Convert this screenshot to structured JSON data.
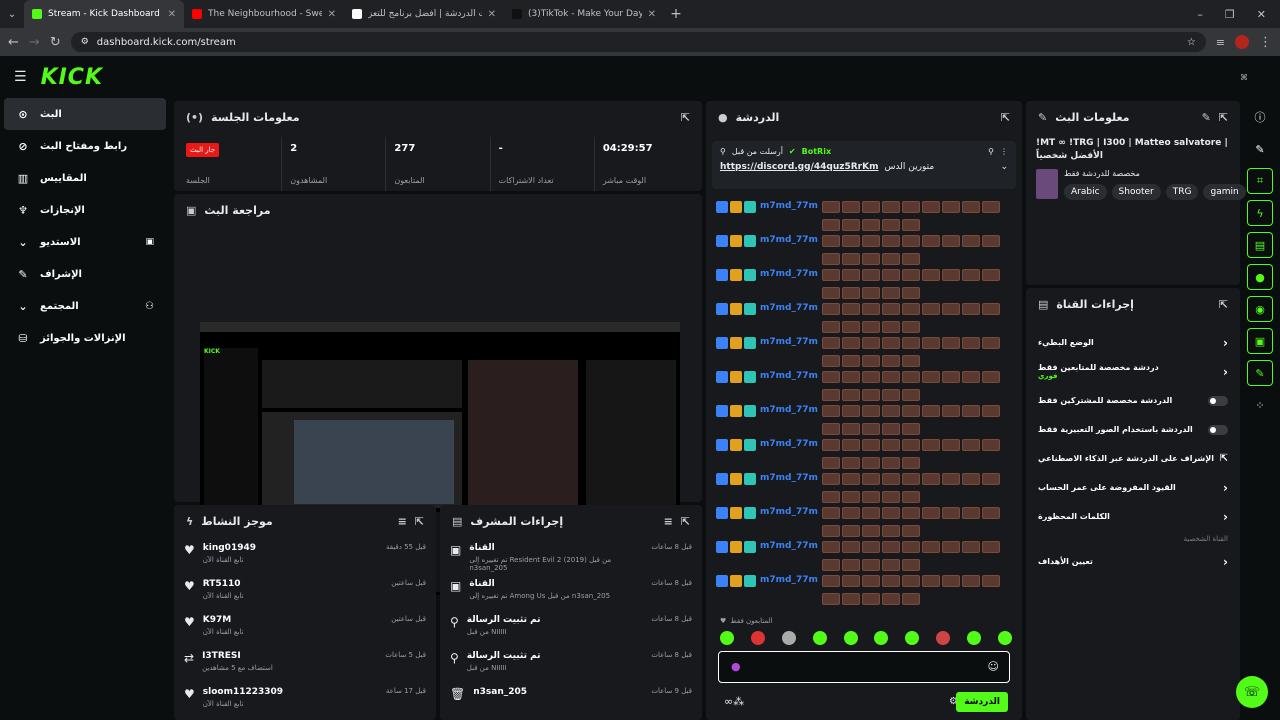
{
  "browser": {
    "tabs": [
      {
        "title": "Stream - Kick Dashboard",
        "favicon_color": "#53fc18",
        "active": true
      },
      {
        "title": "The Neighbourhood - Sweater",
        "favicon_color": "#ff0000",
        "active": false
      },
      {
        "title": "بوت الدردشة | أفضل برنامج للتعز",
        "favicon_color": "#ffffff",
        "active": false
      },
      {
        "title": "(3)TikTok - Make Your Day",
        "favicon_color": "#111111",
        "active": false
      }
    ],
    "url": "dashboard.kick.com/stream"
  },
  "brand": {
    "logo": "KICK",
    "accent": "#53fc18"
  },
  "sidebar": {
    "items": [
      {
        "label": "البث",
        "icon": "broadcast-icon",
        "glyph": "⊙"
      },
      {
        "label": "رابط ومفتاح البث",
        "icon": "link-icon",
        "glyph": "⊘"
      },
      {
        "label": "المقاييس",
        "icon": "chart-icon",
        "glyph": "▥"
      },
      {
        "label": "الإنجازات",
        "icon": "trophy-icon",
        "glyph": "♆"
      },
      {
        "label": "الاستديو",
        "icon": "chevron-down-icon",
        "glyph": "⌄"
      },
      {
        "label": "الإشراف",
        "icon": "wrench-icon",
        "glyph": "✎"
      },
      {
        "label": "المجتمع",
        "icon": "chevron-down-icon",
        "glyph": "⌄"
      },
      {
        "label": "الإنزالات والجوائز",
        "icon": "drops-icon",
        "glyph": "⛁"
      }
    ]
  },
  "session": {
    "title": "معلومات الجلسة",
    "stats": [
      {
        "value": "جار البث",
        "label": "الجلسة"
      },
      {
        "value": "2",
        "label": "المشاهدون"
      },
      {
        "value": "277",
        "label": "المتابعون"
      },
      {
        "value": "-",
        "label": "تعداد الاشتراكات"
      },
      {
        "value": "04:29:57",
        "label": "الوقت مباشر"
      }
    ]
  },
  "preview": {
    "title": "مراجعة البث"
  },
  "activity": {
    "title": "موجز النشاط",
    "rows": [
      {
        "name": "king01949",
        "sub": "تابع القناة الآن",
        "time": "قبل 55 دقيقة",
        "icon": "heart-icon",
        "glyph": "♥"
      },
      {
        "name": "RT5110",
        "sub": "تابع القناة الآن",
        "time": "قبل ساعتين",
        "icon": "heart-icon",
        "glyph": "♥"
      },
      {
        "name": "K97M",
        "sub": "تابع القناة الآن",
        "time": "قبل ساعتين",
        "icon": "heart-icon",
        "glyph": "♥"
      },
      {
        "name": "I3TRESI",
        "sub": "استضاف مع 5 مشاهدين",
        "time": "قبل 5 ساعات",
        "icon": "host-icon",
        "glyph": "⇄"
      },
      {
        "name": "sloom11223309",
        "sub": "تابع القناة الآن",
        "time": "قبل 17 ساعة",
        "icon": "heart-icon",
        "glyph": "♥"
      }
    ]
  },
  "modactions": {
    "title": "إجراءات المشرف",
    "rows": [
      {
        "name": "القناة",
        "sub": "تم تغييره إلى Resident Evil 2 (2019) من قبل n3san_205",
        "time": "قبل 8 ساعات",
        "icon": "channel-icon",
        "glyph": "▣"
      },
      {
        "name": "القناة",
        "sub": "تم تغييره إلى Among Us من قبل n3san_205",
        "time": "قبل 8 ساعات",
        "icon": "channel-icon",
        "glyph": "▣"
      },
      {
        "name": "تم تثبيت الرسالة",
        "sub": "من قبل NIIIII",
        "time": "قبل 8 ساعات",
        "icon": "pin-icon",
        "glyph": "⚲"
      },
      {
        "name": "تم تثبيت الرسالة",
        "sub": "من قبل NIIIII",
        "time": "قبل 8 ساعات",
        "icon": "pin-icon",
        "glyph": "⚲"
      },
      {
        "name": "n3san_205",
        "sub": "",
        "time": "قبل 9 ساعات",
        "icon": "trash-icon",
        "glyph": "🗑"
      }
    ]
  },
  "chat": {
    "title": "الدردشة",
    "pinned_by": "أرسلت من قبل",
    "pinned_user": "BotRix",
    "pinned_text": "https://discord.gg/44quz5RrKm",
    "pinned_suffix": "متورين الدس",
    "username": "m7md_77m",
    "followers_only": "المتابعون فقط",
    "send_label": "الدردشة"
  },
  "streaminfo": {
    "title": "معلومات البث",
    "stream_title": "!MT ∞ !TRG | I300 | Matteo salvatore | الأفضل شخصياً",
    "category": "مخصصة للدردشة فقط",
    "tags": [
      "Arabic",
      "Shooter",
      "TRG",
      "gamin"
    ]
  },
  "channelactions": {
    "title": "إجراءات القناة",
    "items": [
      {
        "label": "الوضع البطيء",
        "control": "chevron"
      },
      {
        "label": "دردشة مخصصة للمتابعين فقط",
        "sub": "فوري",
        "control": "chevron"
      },
      {
        "label": "الدردشة مخصصة للمشتركين فقط",
        "control": "toggle"
      },
      {
        "label": "الدردشة باستخدام الصور التعبيرية فقط",
        "control": "toggle"
      },
      {
        "label": "الإشراف على الدردشة عبر الذكاء الاصطناعي",
        "control": "external"
      },
      {
        "label": "القيود المفروضة على عمر الحساب",
        "control": "chevron"
      },
      {
        "label": "الكلمات المحظورة",
        "control": "chevron"
      }
    ],
    "section_label": "القناة الشخصية",
    "goals_label": "تعيين الأهداف"
  }
}
